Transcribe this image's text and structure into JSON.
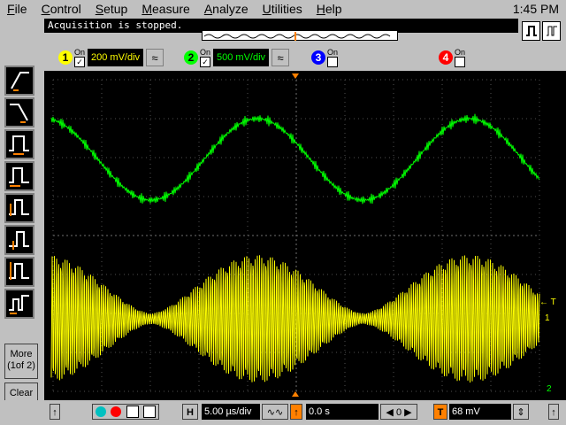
{
  "menu": [
    "File",
    "Control",
    "Setup",
    "Measure",
    "Analyze",
    "Utilities",
    "Help"
  ],
  "clock": "1:45 PM",
  "status_text": "Acquisition is stopped.",
  "channels": [
    {
      "num": "1",
      "on_label": "On",
      "checked": true,
      "scale": "200 mV/div",
      "color": "#ffff00"
    },
    {
      "num": "2",
      "on_label": "On",
      "checked": true,
      "scale": "500 mV/div",
      "color": "#00ff00"
    },
    {
      "num": "3",
      "on_label": "On",
      "checked": false,
      "scale": "",
      "color": "#0000ff"
    },
    {
      "num": "4",
      "on_label": "On",
      "checked": false,
      "scale": "",
      "color": "#ff0000"
    }
  ],
  "sidebar": {
    "more_label": "More (1of 2)",
    "clear_label": "Clear All"
  },
  "timebase": {
    "h_label": "H",
    "scale": "5.00 µs/div",
    "delay": "0.0 s"
  },
  "trigger": {
    "t_label": "T",
    "level": "68 mV",
    "marker_label": "← T"
  },
  "icons": {
    "accent_yellow": "#ffff00",
    "accent_green": "#00ff00",
    "trigger_orange": "#ff8000"
  }
}
